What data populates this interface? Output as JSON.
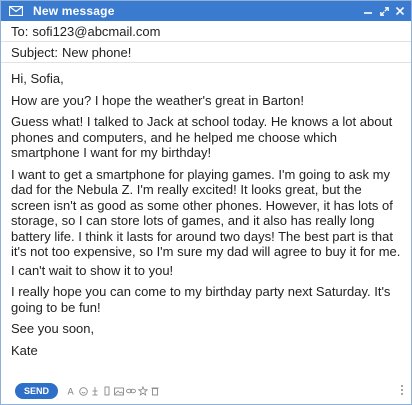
{
  "window": {
    "title": "New message",
    "accent": "#3a7bd0"
  },
  "compose": {
    "to_label": "To:",
    "to_value": "sofi123@abcmail.com",
    "subject_label": "Subject:",
    "subject_value": "New phone!"
  },
  "message": {
    "paragraphs": [
      "Hi, Sofia,",
      "How are you? I hope the weather's great in Barton!",
      "Guess what! I talked to Jack at school today. He knows a lot about phones and computers, and he helped me choose which smartphone I want for my birthday!",
      "I want to get a smartphone for playing games. I'm going to ask my dad for the Nebula Z. I'm really excited! It looks great, but the screen isn't as good as some other phones. However, it has lots of storage, so I can store lots of games, and it also has really long battery life. I think it lasts for around two days! The best part is that it's not too expensive, so I'm sure my dad will agree to buy it for me.",
      "I can't wait to show it to you!",
      "I really hope you can come to my birthday party next Saturday. It's going to be fun!",
      "See you soon,",
      "Kate"
    ]
  },
  "toolbar": {
    "send_label": "SEND",
    "icons": [
      "text-format-icon",
      "emoji-icon",
      "attach-icon",
      "drive-icon",
      "image-icon",
      "link-icon",
      "star-icon",
      "trash-icon",
      "more-options-icon"
    ]
  }
}
